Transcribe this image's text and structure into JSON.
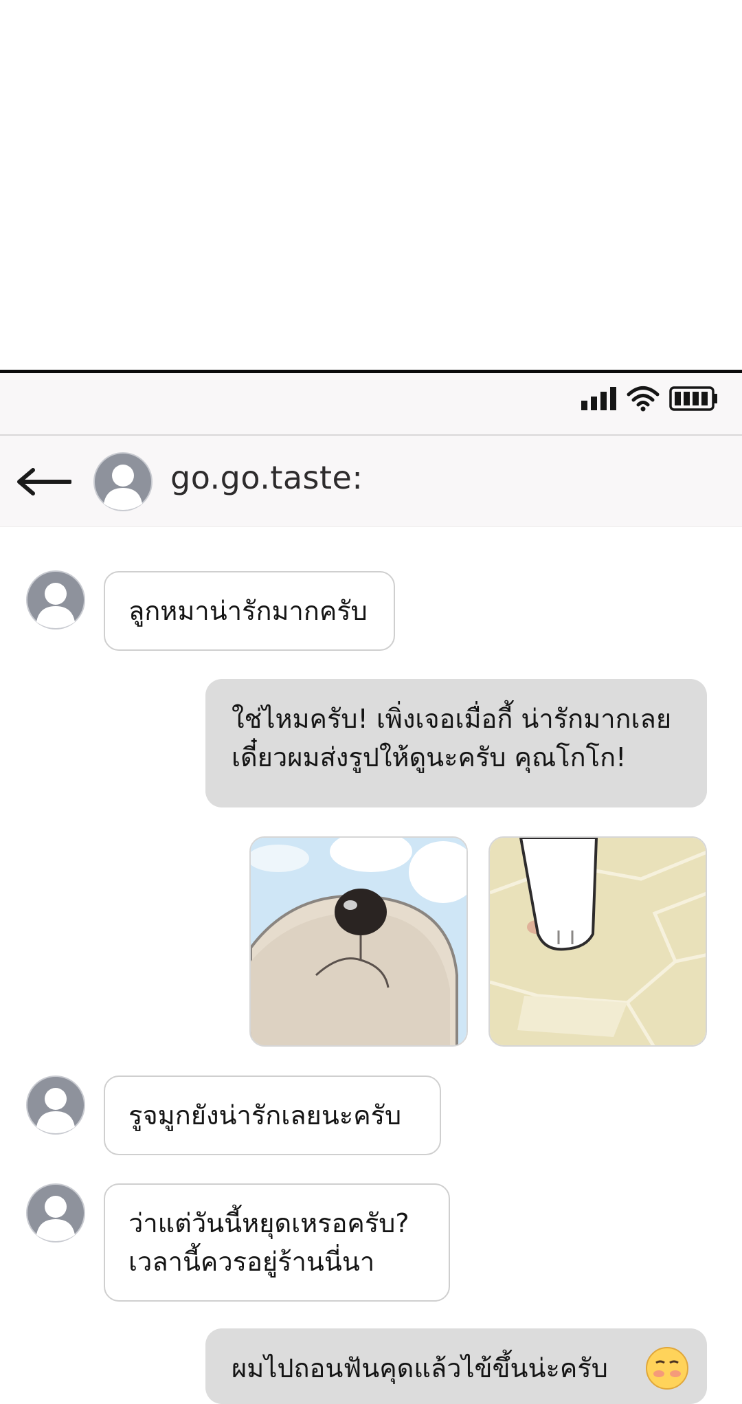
{
  "contact": {
    "name": "go.go.taste:"
  },
  "status_icons": [
    "signal-icon",
    "wifi-icon",
    "battery-icon"
  ],
  "messages": [
    {
      "direction": "incoming",
      "lines": [
        "ลูกหมาน่ารักมากครับ"
      ]
    },
    {
      "direction": "outgoing",
      "lines": [
        "ใช่ไหมครับ! เพิ่งเจอเมื่อกี้ น่ารักมากเลย",
        "เดี๋ยวผมส่งรูปให้ดูนะครับ คุณโกโก!"
      ]
    },
    {
      "direction": "outgoing",
      "type": "photos",
      "photos": [
        "puppy-nose-photo",
        "puppy-paw-photo"
      ]
    },
    {
      "direction": "incoming",
      "lines": [
        "รูจมูกยังน่ารักเลยนะครับ"
      ]
    },
    {
      "direction": "incoming",
      "lines": [
        "ว่าแต่วันนี้หยุดเหรอครับ?",
        "เวลานี้ควรอยู่ร้านนี่นา"
      ]
    },
    {
      "direction": "outgoing",
      "lines": [
        "ผมไปถอนฟันคุดแล้วไข้ขึ้นน่ะครับ"
      ],
      "emoji": "hot-face-emoji"
    }
  ],
  "colors": {
    "outgoing_bubble": "#dcdcdc",
    "incoming_bubble": "#ffffff",
    "header_bg": "#f9f7f8",
    "avatar": "#8e929c"
  }
}
